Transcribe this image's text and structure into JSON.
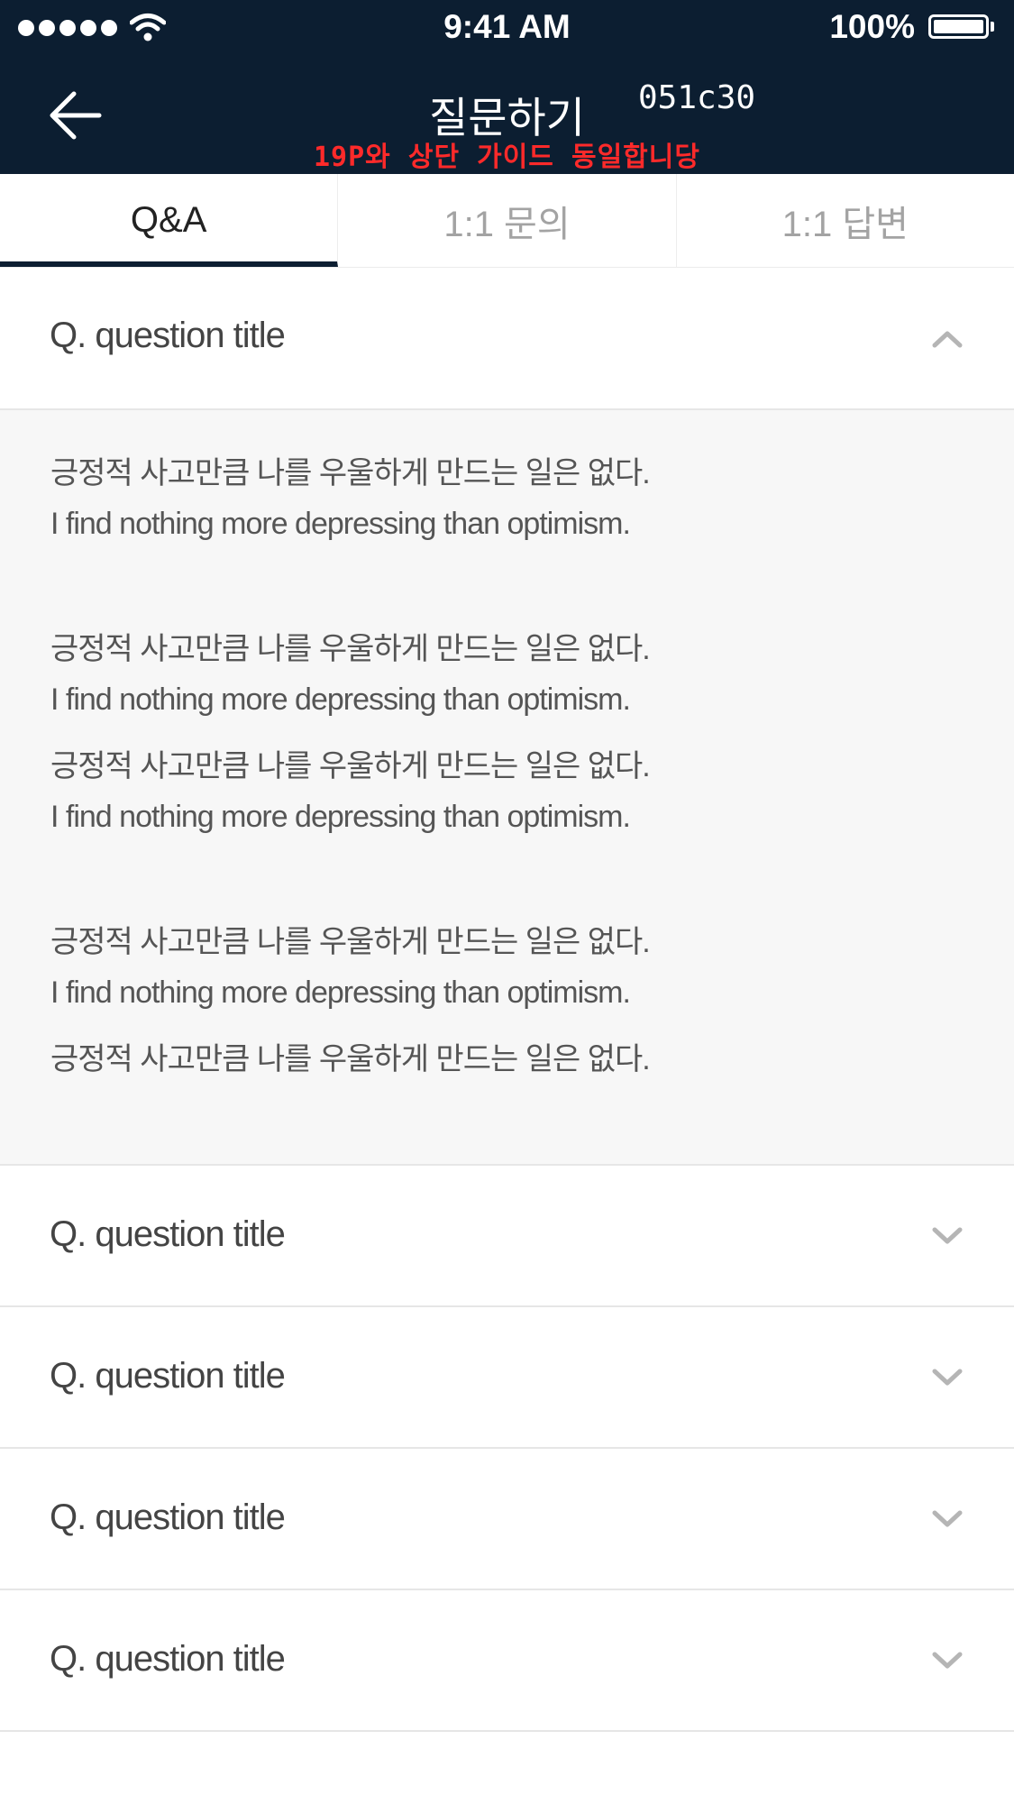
{
  "status_bar": {
    "time": "9:41 AM",
    "battery": "100%",
    "icons": [
      "signal-dots-icon",
      "wifi-icon",
      "battery-icon"
    ]
  },
  "nav": {
    "back_icon": "arrow-left-icon",
    "title": "질문하기",
    "code": "051c30",
    "guide_note": "19P와 상단 가이드 동일합니당"
  },
  "tabs": [
    {
      "label": "Q&A",
      "active": true
    },
    {
      "label": "1:1 문의",
      "active": false
    },
    {
      "label": "1:1 답변",
      "active": false
    }
  ],
  "faq": {
    "items": [
      {
        "title": "Q. question title",
        "expanded": true,
        "icon": "chevron-up-icon"
      },
      {
        "title": "Q. question title",
        "expanded": false,
        "icon": "chevron-down-icon"
      },
      {
        "title": "Q. question title",
        "expanded": false,
        "icon": "chevron-down-icon"
      },
      {
        "title": "Q. question title",
        "expanded": false,
        "icon": "chevron-down-icon"
      },
      {
        "title": "Q. question title",
        "expanded": false,
        "icon": "chevron-down-icon"
      }
    ],
    "answer_lines": [
      "긍정적 사고만큼 나를 우울하게 만드는 일은 없다.",
      "I find nothing more depressing than optimism.",
      "긍정적 사고만큼 나를 우울하게 만드는 일은 없다.",
      "I find nothing more depressing than optimism.",
      "긍정적 사고만큼 나를 우울하게 만드는 일은 없다.",
      "I find nothing more depressing than optimism.",
      "긍정적 사고만큼 나를 우울하게 만드는 일은 없다.",
      "I find nothing more depressing than optimism.",
      "긍정적 사고만큼 나를 우울하게 만드는 일은 없다."
    ]
  },
  "colors": {
    "header_bg": "#0c1e31",
    "guide_note": "#ff2a2a",
    "answer_bg": "#f7f7f7"
  }
}
